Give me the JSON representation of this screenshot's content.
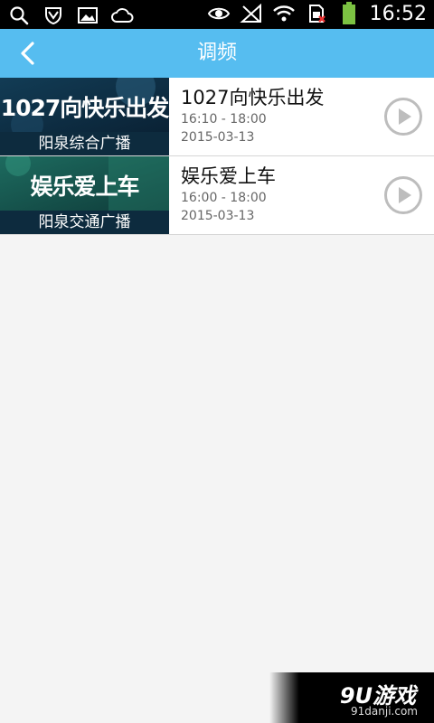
{
  "status_bar": {
    "time": "16:52",
    "icons_left": [
      "search-icon",
      "shield-icon",
      "image-icon",
      "cloud-icon"
    ],
    "icons_right": [
      "eye-icon",
      "no-signal-icon",
      "wifi-icon",
      "sim-icon",
      "battery-icon"
    ]
  },
  "header": {
    "title": "调频"
  },
  "programs": [
    {
      "thumb_text": "1027向快乐出发",
      "channel": "阳泉综合广播",
      "name": "1027向快乐出发",
      "time": "16:10 - 18:00",
      "date": "2015-03-13"
    },
    {
      "thumb_text": "娱乐爱上车",
      "channel": "阳泉交通广播",
      "name": "娱乐爱上车",
      "time": "16:00 - 18:00",
      "date": "2015-03-13"
    }
  ],
  "watermark": {
    "logo": "9U游戏",
    "url": "91danji.com"
  },
  "colors": {
    "header": "#56bdf0",
    "background": "#f4f4f4",
    "play_icon": "#bdbdbd",
    "battery": "#7cc242"
  }
}
